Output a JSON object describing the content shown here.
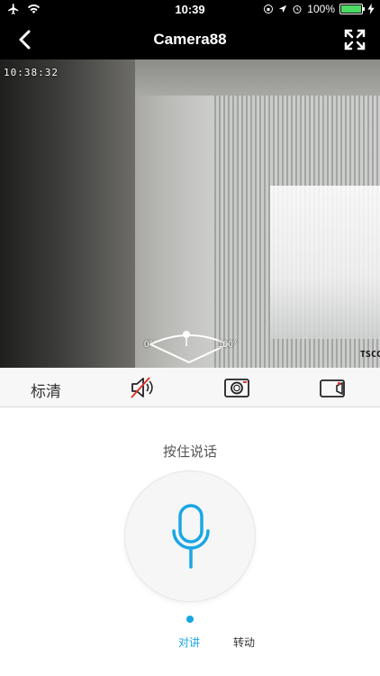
{
  "status_bar": {
    "time": "10:39",
    "battery_text": "100%",
    "battery_level": 1.0
  },
  "nav": {
    "title": "Camera88"
  },
  "video": {
    "timestamp": "10:38:32",
    "pan_min_label": "0°",
    "pan_max_label": "100°",
    "watermark": "TSCC"
  },
  "toolbar": {
    "quality_label": "标清"
  },
  "talk_panel": {
    "hint": "按住说话"
  },
  "tabs": [
    {
      "label": "对讲",
      "active": true
    },
    {
      "label": "转动",
      "active": false
    }
  ],
  "colors": {
    "accent": "#1aa6e4",
    "mute_red": "#e0332c"
  }
}
